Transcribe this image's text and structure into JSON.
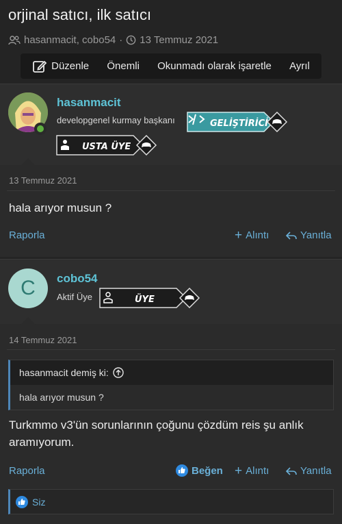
{
  "thread": {
    "title": "orjinal satıcı, ilk satıcı",
    "participants": "hasanmacit, cobo54",
    "date": "13 Temmuz 2021"
  },
  "toolbar": {
    "edit": "Düzenle",
    "important": "Önemli",
    "mark_unread": "Okunmadı olarak işaretle",
    "leave": "Ayrıl"
  },
  "posts": [
    {
      "username": "hasanmacit",
      "user_title": "developgenel kurmay başkanı",
      "banners": [
        "GELİŞTİRİCİ",
        "USTA ÜYE"
      ],
      "date": "13 Temmuz 2021",
      "body": "hala arıyor musun ?",
      "actions": {
        "report": "Raporla",
        "quote": "Alıntı",
        "reply": "Yanıtla"
      }
    },
    {
      "username": "cobo54",
      "avatar_letter": "C",
      "user_title": "Aktif Üye",
      "banners": [
        "ÜYE"
      ],
      "date": "14 Temmuz 2021",
      "quote_author": "hasanmacit demiş ki:",
      "quote_text": "hala arıyor musun ?",
      "body": "Turkmmo v3'ün sorunlarının çoğunu çözdüm reis şu anlık aramıyorum.",
      "actions": {
        "report": "Raporla",
        "like": "Beğen",
        "quote": "Alıntı",
        "reply": "Yanıtla"
      },
      "reactions": "Siz"
    }
  ],
  "colors": {
    "background": "#242424",
    "link": "#6ab0d8",
    "username": "#5ec3d6",
    "developer_banner": "#3a9aa0",
    "online": "#5fb040"
  }
}
